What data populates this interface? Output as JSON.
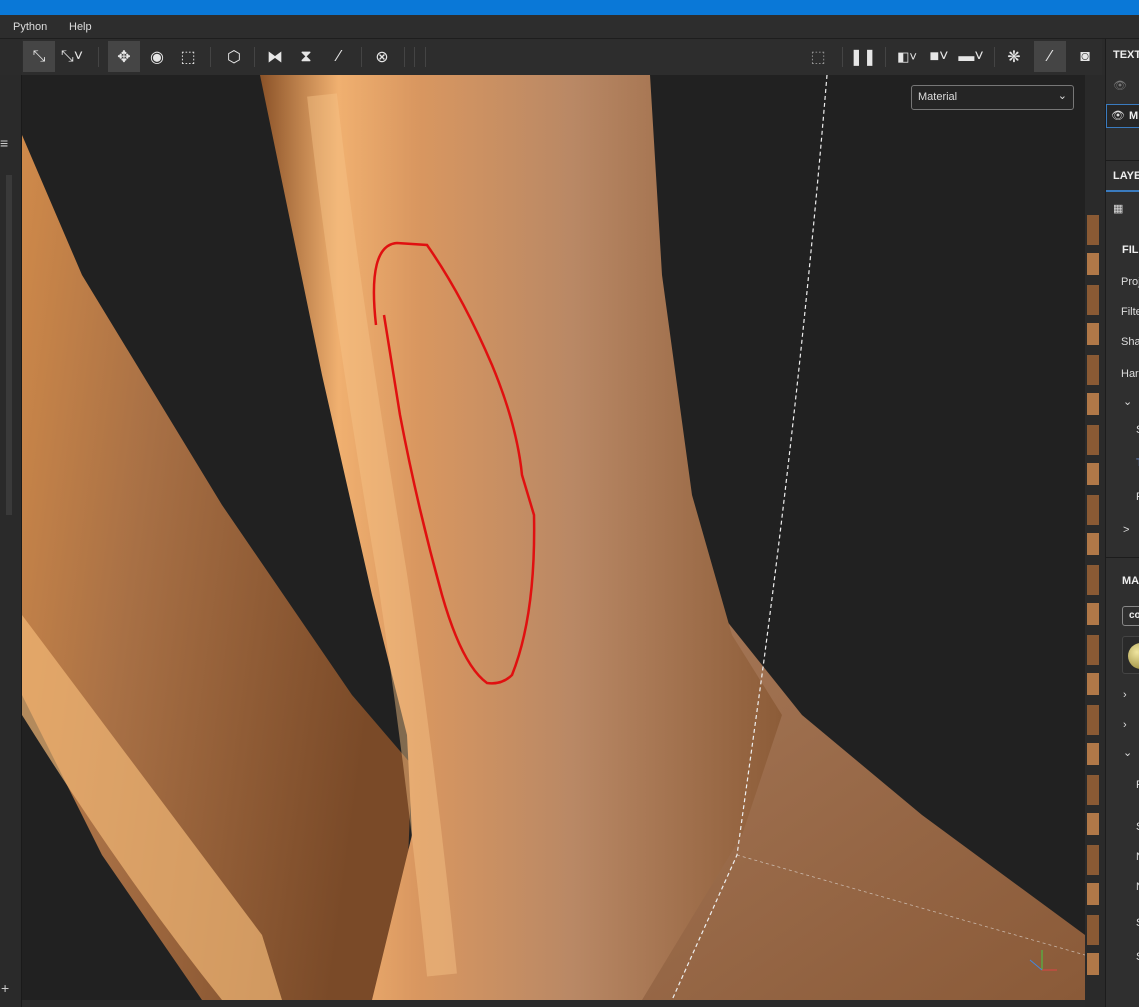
{
  "menu": {
    "items": [
      "Python",
      "Help"
    ]
  },
  "toolbar": {
    "left": [
      "transform-icon",
      "transform-settings-icon",
      "move-icon",
      "rotate-icon",
      "scale-icon",
      "cube-dropdown-icon",
      "mirror-x-icon",
      "mirror-y-icon",
      "symmetry-icon",
      "reset-icon"
    ],
    "right": [
      "hide-selection-icon",
      "pause-icon",
      "split-view-icon",
      "cube-view-icon",
      "camera-icon",
      "bake-icon",
      "paint-brush-icon",
      "screenshot-icon"
    ]
  },
  "viewport": {
    "display_mode": "Material"
  },
  "panel": {
    "texture_title": "TEXT",
    "texture_item": "M",
    "layers_title": "LAYE",
    "filter_title": "FIL",
    "rows": [
      "Proj",
      "Filte",
      "Sha",
      "Har"
    ],
    "sub_rows": [
      "S",
      "T",
      "F"
    ],
    "collapsed": ">",
    "material_title": "MA",
    "material_button": "co",
    "material_rows": [
      "F",
      "S",
      "N",
      "N",
      "S",
      "S"
    ]
  },
  "colors": {
    "accent": "#0a78d7",
    "annotation": "#e01010",
    "copper": "#c98a55"
  }
}
